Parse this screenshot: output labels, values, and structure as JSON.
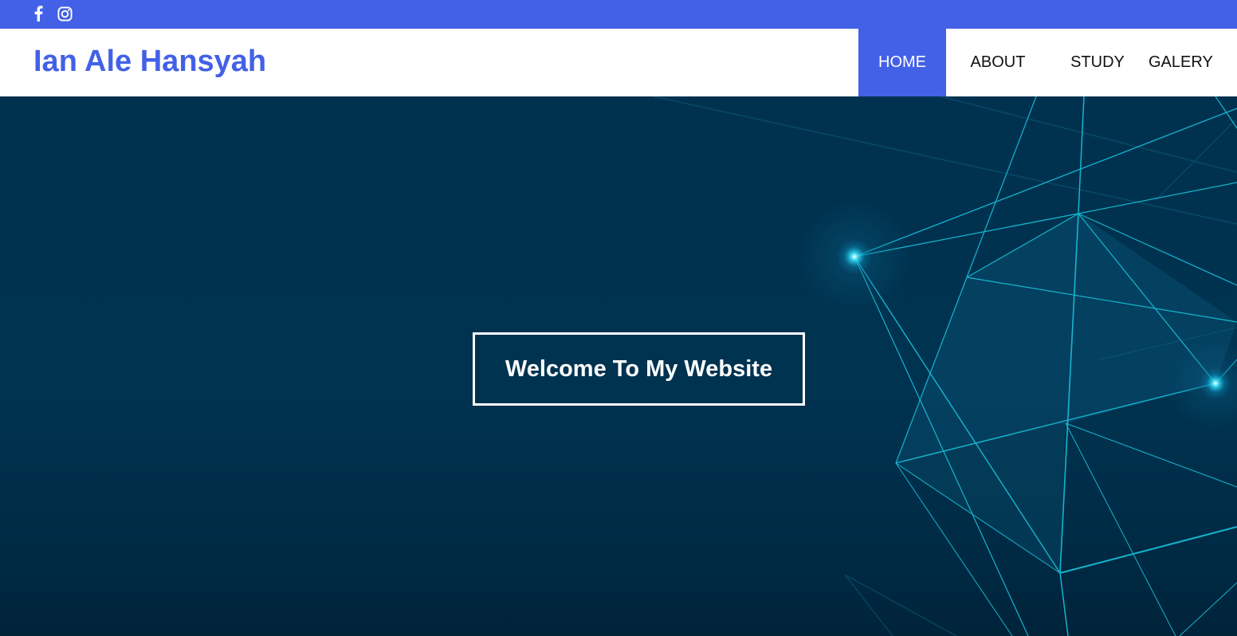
{
  "topbar": {
    "background": "#4361e6",
    "social": [
      {
        "icon": "facebook-icon"
      },
      {
        "icon": "instagram-icon"
      }
    ]
  },
  "navbar": {
    "brand": "Ian Ale Hansyah",
    "brand_color": "#4361e6",
    "menu": [
      {
        "label": "HOME",
        "active": true
      },
      {
        "label": "ABOUT",
        "active": false
      },
      {
        "label": "STUDY",
        "active": false
      },
      {
        "label": "GALERY",
        "active": false
      }
    ]
  },
  "hero": {
    "welcome_text": "Welcome To My Website",
    "background": "#00304d",
    "accent": "#19c3dc"
  }
}
